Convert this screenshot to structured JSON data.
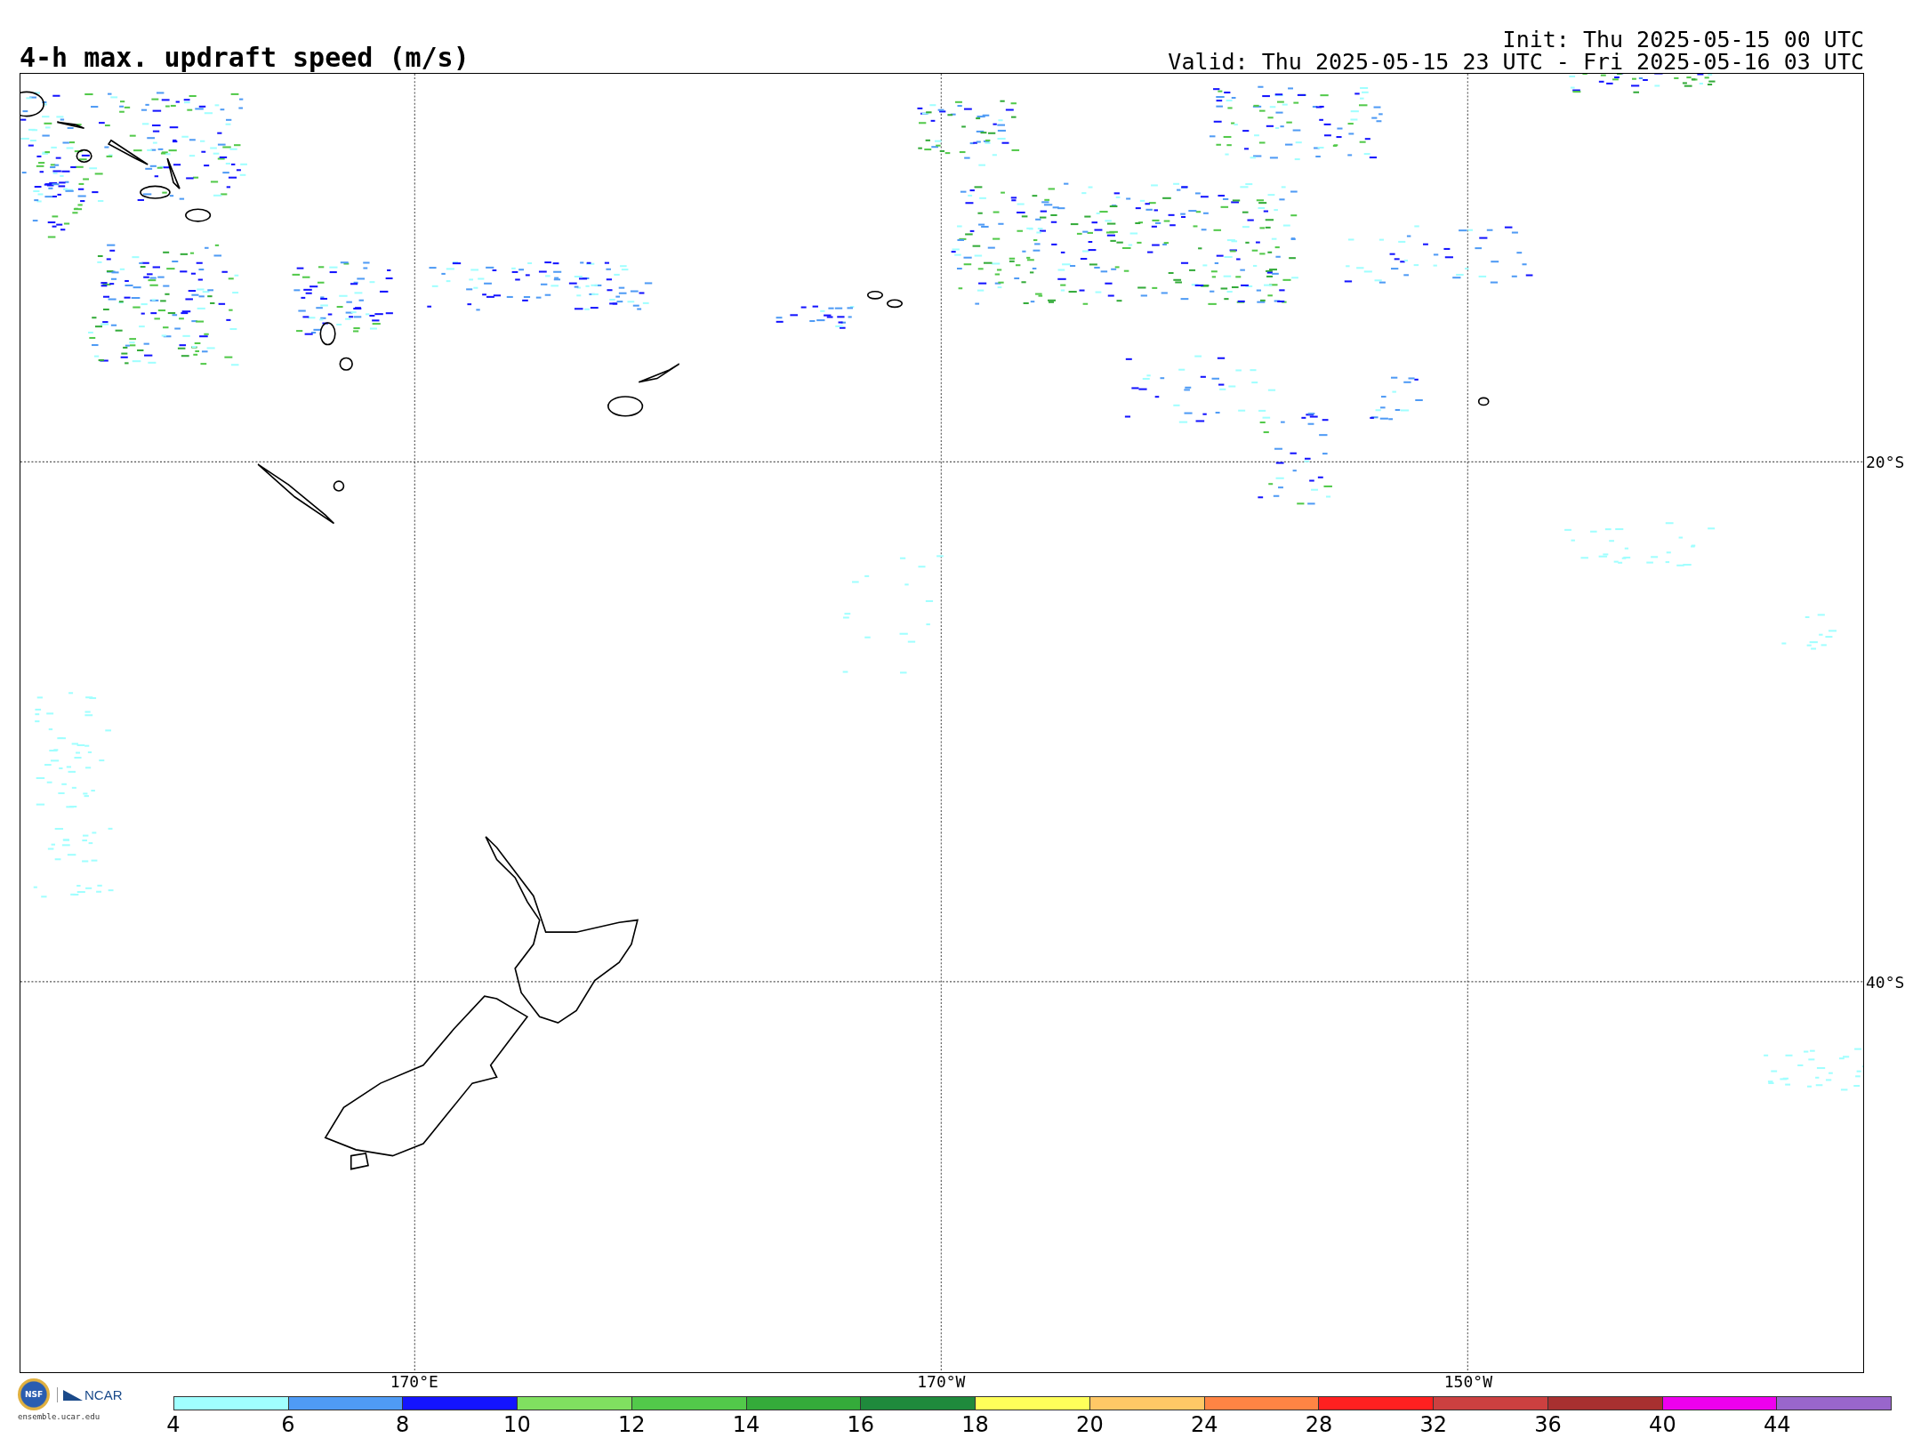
{
  "title": "4-h max. updraft speed (m/s)",
  "init": "Init: Thu 2025-05-15 00 UTC",
  "valid": "Valid: Thu 2025-05-15 23 UTC - Fri 2025-05-16 03 UTC",
  "lat_labels": [
    "20°S",
    "40°S"
  ],
  "lon_labels": [
    "170°E",
    "170°W",
    "150°W"
  ],
  "logos": {
    "nsf": "NSF",
    "ncar": "NCAR",
    "url": "ensemble.ucar.edu"
  },
  "colorbar": {
    "segments": [
      {
        "color": "#a0ffff"
      },
      {
        "color": "#4f9bf5"
      },
      {
        "color": "#1414ff"
      },
      {
        "color": "#80e060"
      },
      {
        "color": "#52c94a"
      },
      {
        "color": "#34ab3a"
      },
      {
        "color": "#1f8a3c"
      },
      {
        "color": "#ffff5a"
      },
      {
        "color": "#ffc866"
      },
      {
        "color": "#ff8444"
      },
      {
        "color": "#ff2020"
      },
      {
        "color": "#cc4040"
      },
      {
        "color": "#a83030"
      },
      {
        "color": "#ee00ee"
      },
      {
        "color": "#9966cc"
      }
    ],
    "ticks": [
      "4",
      "6",
      "8",
      "10",
      "12",
      "14",
      "16",
      "18",
      "20",
      "24",
      "28",
      "32",
      "36",
      "40",
      "44"
    ]
  }
}
